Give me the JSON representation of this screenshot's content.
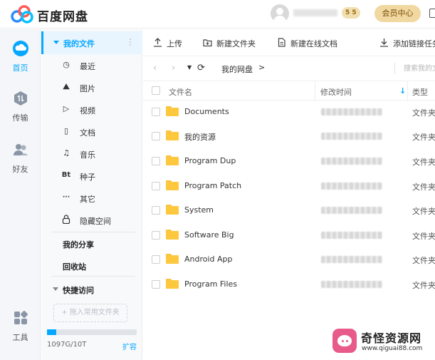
{
  "app": {
    "brand": "百度网盘"
  },
  "header": {
    "badge_text": "5",
    "vip_button": "会员中心"
  },
  "rail": {
    "items": [
      {
        "label": "首页",
        "icon": "cloud-icon",
        "active": true
      },
      {
        "label": "传输",
        "icon": "transfer-icon",
        "active": false
      },
      {
        "label": "好友",
        "icon": "friends-icon",
        "active": false
      },
      {
        "label": "工具",
        "icon": "tools-icon",
        "active": false
      }
    ]
  },
  "categories": {
    "header": "我的文件",
    "more": "⋮",
    "items": [
      {
        "label": "最近",
        "icon": "clock-icon",
        "glyph": "◷"
      },
      {
        "label": "图片",
        "icon": "image-icon",
        "glyph": "⛰"
      },
      {
        "label": "视频",
        "icon": "play-icon",
        "glyph": "▷"
      },
      {
        "label": "文档",
        "icon": "document-icon",
        "glyph": "▯"
      },
      {
        "label": "音乐",
        "icon": "headphones-icon",
        "glyph": "♫"
      },
      {
        "label": "种子",
        "icon": "bt-icon",
        "glyph": "Bt"
      },
      {
        "label": "其它",
        "icon": "more-icon",
        "glyph": "···"
      },
      {
        "label": "隐藏空间",
        "icon": "lock-icon",
        "glyph": "🔒"
      }
    ],
    "my_share": "我的分享",
    "recycle_bin": "回收站",
    "quick_access": "快捷访问",
    "drag_hint": "+ 拖入常用文件夹",
    "quota_text": "1097G/10T",
    "quota_used_fraction": 0.107,
    "expand": "扩容"
  },
  "toolbar": {
    "upload": "上传",
    "new_folder": "新建文件夹",
    "new_online_doc": "新建在线文档",
    "add_link_task": "添加链接任务"
  },
  "nav": {
    "breadcrumb": "我的网盘",
    "crumb_arrow": ">",
    "search_placeholder": "搜索我的文件"
  },
  "table": {
    "columns": {
      "name": "文件名",
      "modified": "修改时间",
      "type": "类型"
    },
    "rows": [
      {
        "name": "Documents",
        "type": "文件夹"
      },
      {
        "name": "我的资源",
        "type": "文件夹"
      },
      {
        "name": "Program Dup",
        "type": "文件夹"
      },
      {
        "name": "Program Patch",
        "type": "文件夹"
      },
      {
        "name": "System",
        "type": "文件夹"
      },
      {
        "name": "Software Big",
        "type": "文件夹"
      },
      {
        "name": "Android App",
        "type": "文件夹"
      },
      {
        "name": "Program Files",
        "type": "文件夹"
      }
    ]
  },
  "watermark": {
    "title": "奇怪资源网",
    "url": "www.qiguai88.com"
  },
  "colors": {
    "accent": "#06a7ff",
    "folder": "#fdc83d",
    "vip": "#f1d8a0"
  }
}
